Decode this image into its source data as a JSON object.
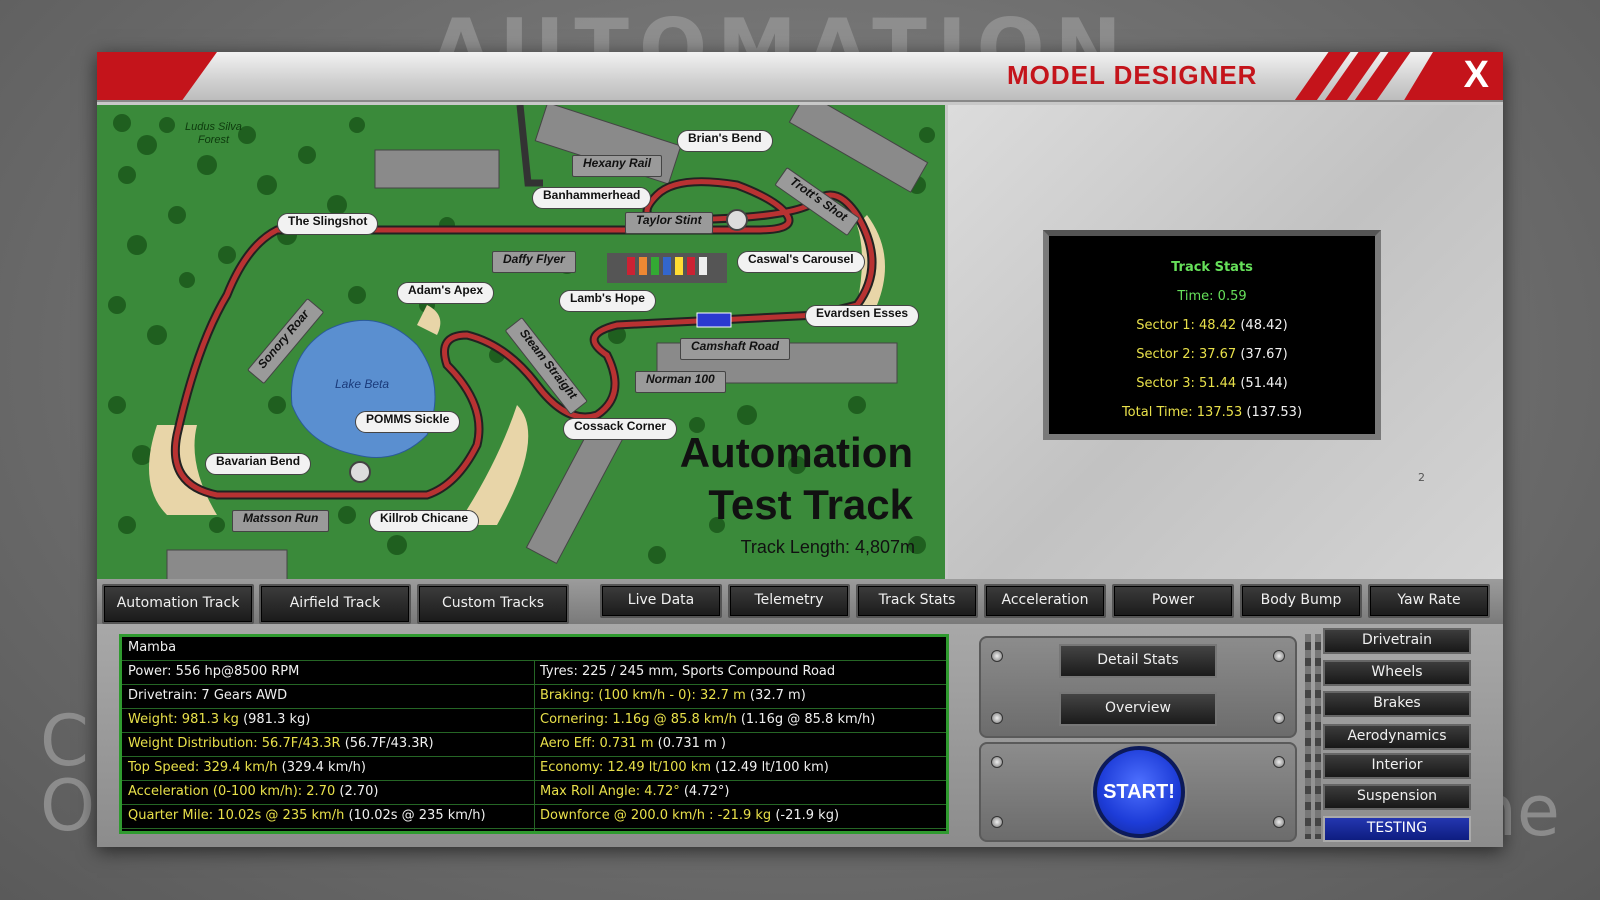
{
  "background": {
    "logo_text": "AUTOMATION",
    "left_text": "C\nO",
    "right_text": "me"
  },
  "window": {
    "title": "MODEL DESIGNER",
    "close_label": "X"
  },
  "map": {
    "forest_label": "Ludus Silva\nForest",
    "lake_label": "Lake Beta",
    "title_line1": "Automation",
    "title_line2": "Test Track",
    "track_length": "Track Length: 4,807m",
    "corners": {
      "brians_bend": "Brian's Bend",
      "hexany_rail": "Hexany Rail",
      "trotts_shot": "Trott's Shot",
      "banhammerhead": "Banhammerhead",
      "taylor_stint": "Taylor Stint",
      "the_slingshot": "The Slingshot",
      "daffy_flyer": "Daffy Flyer",
      "caswals_carousel": "Caswal's Carousel",
      "adams_apex": "Adam's Apex",
      "lambs_hope": "Lamb's Hope",
      "evardsen_esses": "Evardsen Esses",
      "sonory_roar": "Sonory Roar",
      "steam_straight": "Steam Straight",
      "camshaft_road": "Camshaft Road",
      "norman_100": "Norman 100",
      "pomms_sickle": "POMMS Sickle",
      "cossack_corner": "Cossack Corner",
      "bavarian_bend": "Bavarian Bend",
      "matsson_run": "Matsson Run",
      "killrob_chicane": "Killrob Chicane"
    }
  },
  "track_stats": {
    "header": "Track Stats",
    "time": "Time: 0.59",
    "rows": [
      {
        "label": "Sector 1: 48.42",
        "best": " (48.42)"
      },
      {
        "label": "Sector 2: 37.67",
        "best": " (37.67)"
      },
      {
        "label": "Sector 3: 51.44",
        "best": " (51.44)"
      },
      {
        "label": "Total Time: 137.53",
        "best": " (137.53)"
      }
    ],
    "page_number": "2"
  },
  "track_tabs": [
    "Automation Track",
    "Airfield Track",
    "Custom Tracks"
  ],
  "data_tabs": [
    "Live Data",
    "Telemetry",
    "Track Stats",
    "Acceleration",
    "Power",
    "Body Bump",
    "Yaw Rate"
  ],
  "car": {
    "name": "Mamba",
    "left": [
      {
        "text": "Power: 556 hp@8500 RPM",
        "extra": "",
        "highlight": false
      },
      {
        "text": "Drivetrain: 7 Gears AWD",
        "extra": "",
        "highlight": false
      },
      {
        "text": "Weight: 981.3 kg",
        "extra": " (981.3 kg)",
        "highlight": true
      },
      {
        "text": "Weight Distribution: 56.7F/43.3R",
        "extra": " (56.7F/43.3R)",
        "highlight": true
      },
      {
        "text": "Top Speed: 329.4 km/h",
        "extra": " (329.4 km/h)",
        "highlight": true
      },
      {
        "text": "Acceleration (0-100 km/h): 2.70",
        "extra": " (2.70)",
        "highlight": true
      },
      {
        "text": "Quarter Mile: 10.02s @ 235 km/h",
        "extra": " (10.02s @ 235 km/h)",
        "highlight": true
      }
    ],
    "right": [
      {
        "text": "Tyres: 225 / 245 mm, Sports Compound Road",
        "extra": "",
        "highlight": false
      },
      {
        "text": "Braking: (100 km/h - 0): 32.7 m",
        "extra": " (32.7 m)",
        "highlight": true
      },
      {
        "text": "Cornering: 1.16g @ 85.8 km/h",
        "extra": " (1.16g @ 85.8 km/h)",
        "highlight": true
      },
      {
        "text": "Aero Eff: 0.731 m",
        "extra": "  (0.731 m )",
        "highlight": true
      },
      {
        "text": "Economy: 12.49 lt/100 km",
        "extra": " (12.49 lt/100 km)",
        "highlight": true
      },
      {
        "text": "Max Roll Angle: 4.72°",
        "extra": " (4.72°)",
        "highlight": true
      },
      {
        "text": "Downforce @ 200.0 km/h : -21.9 kg",
        "extra": " (-21.9 kg)",
        "highlight": true
      }
    ]
  },
  "buttons": {
    "detail_stats": "Detail Stats",
    "overview": "Overview",
    "start": "START!"
  },
  "side_menu": [
    {
      "label": "Drivetrain",
      "active": false
    },
    {
      "label": "Wheels",
      "active": false
    },
    {
      "label": "Brakes",
      "active": false
    },
    {
      "label": "Aerodynamics",
      "active": false
    },
    {
      "label": "Interior",
      "active": false
    },
    {
      "label": "Suspension",
      "active": false
    },
    {
      "label": "TESTING",
      "active": true
    }
  ],
  "colors": {
    "accent_red": "#c4141b",
    "stat_green": "#66e05a",
    "stat_yellow": "#e8e04a",
    "start_blue": "#1d3cd8"
  }
}
